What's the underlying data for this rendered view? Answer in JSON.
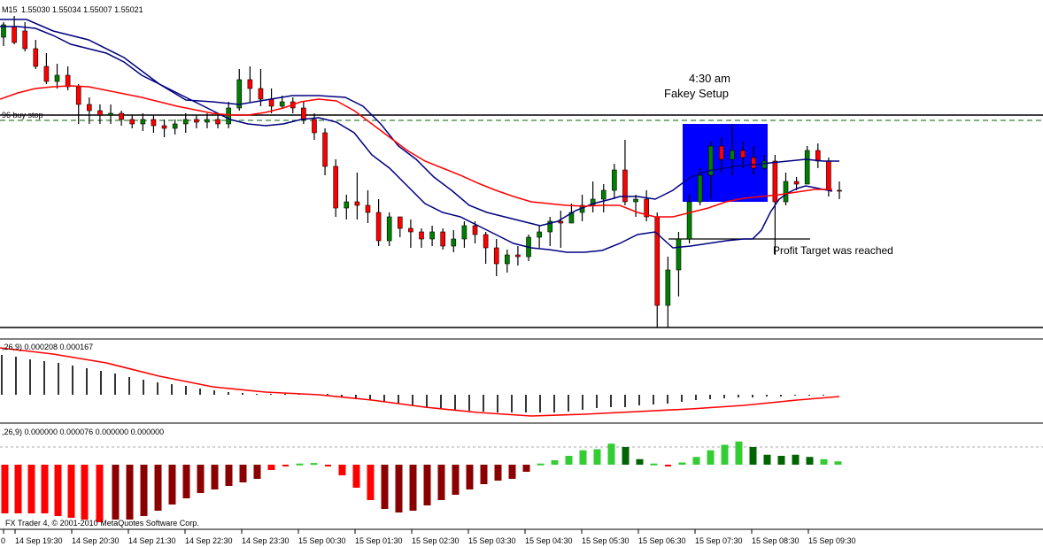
{
  "window": {
    "timeframe": "M15",
    "ohlc_readout": "1.55030 1.55034 1.55007 1.55021"
  },
  "annotations": {
    "time_label": "4:30 am",
    "setup_label": "Fakey Setup",
    "target_label": "Profit Target was reached",
    "buy_stop_label": "96 buy stop"
  },
  "indicators": {
    "macd_header": ",26,9) 0.000208 0.000167",
    "osma_header": ",26,9) 0.000000 0.000076 0.000000 0.000000"
  },
  "footer": {
    "copyright": "FX Trader 4, © 2001-2010 MetaQuotes Software Corp."
  },
  "colors": {
    "bull": "#008000",
    "bear": "#ff0000",
    "ma_fast": "#000080",
    "ma_slow": "#ff0000",
    "setup_box": "#0000ff",
    "hist_up": "#33cc33",
    "hist_up_dark": "#006400",
    "hist_down": "#ff0000",
    "hist_down_dark": "#8b0000"
  },
  "chart_data": {
    "type": "candlestick",
    "x_ticks": [
      "0",
      "14 Sep 19:30",
      "14 Sep 20:30",
      "14 Sep 21:30",
      "14 Sep 22:30",
      "14 Sep 23:30",
      "15 Sep 00:30",
      "15 Sep 01:30",
      "15 Sep 02:30",
      "15 Sep 03:30",
      "15 Sep 04:30",
      "15 Sep 05:30",
      "15 Sep 06:30",
      "15 Sep 07:30",
      "15 Sep 08:30",
      "15 Sep 09:30"
    ],
    "price_bars": [
      [
        42,
        28,
        25,
        52
      ],
      [
        30,
        48,
        18,
        50
      ],
      [
        35,
        55,
        25,
        58
      ],
      [
        55,
        75,
        45,
        78
      ],
      [
        75,
        92,
        60,
        95
      ],
      [
        92,
        85,
        72,
        100
      ],
      [
        85,
        98,
        75,
        102
      ],
      [
        98,
        118,
        95,
        140
      ],
      [
        118,
        125,
        110,
        140
      ],
      [
        125,
        130,
        118,
        140
      ],
      [
        130,
        128,
        118,
        140
      ],
      [
        128,
        135,
        125,
        142
      ],
      [
        135,
        140,
        130,
        145
      ],
      [
        140,
        135,
        128,
        148
      ],
      [
        135,
        142,
        130,
        150
      ],
      [
        142,
        145,
        135,
        155
      ],
      [
        145,
        140,
        135,
        152
      ],
      [
        140,
        135,
        128,
        150
      ],
      [
        135,
        138,
        130,
        145
      ],
      [
        138,
        135,
        128,
        145
      ],
      [
        135,
        140,
        130,
        145
      ],
      [
        140,
        122,
        115,
        145
      ],
      [
        122,
        90,
        78,
        125
      ],
      [
        90,
        100,
        75,
        115
      ],
      [
        100,
        112,
        78,
        120
      ],
      [
        112,
        120,
        100,
        128
      ],
      [
        120,
        115,
        108,
        122
      ],
      [
        115,
        122,
        110,
        128
      ],
      [
        122,
        135,
        115,
        140
      ],
      [
        135,
        150,
        128,
        158
      ],
      [
        150,
        188,
        145,
        198
      ],
      [
        188,
        235,
        180,
        245
      ],
      [
        235,
        228,
        220,
        248
      ],
      [
        228,
        232,
        195,
        248
      ],
      [
        232,
        240,
        215,
        252
      ],
      [
        240,
        272,
        225,
        278
      ],
      [
        272,
        245,
        240,
        278
      ],
      [
        245,
        258,
        245,
        268
      ],
      [
        258,
        262,
        248,
        280
      ],
      [
        262,
        270,
        258,
        280
      ],
      [
        270,
        262,
        255,
        278
      ],
      [
        262,
        278,
        258,
        282
      ],
      [
        278,
        270,
        260,
        285
      ],
      [
        270,
        255,
        250,
        280
      ],
      [
        255,
        265,
        250,
        275
      ],
      [
        265,
        280,
        262,
        298
      ],
      [
        280,
        298,
        270,
        312
      ],
      [
        298,
        288,
        282,
        308
      ],
      [
        288,
        290,
        278,
        300
      ],
      [
        290,
        268,
        265,
        295
      ],
      [
        268,
        262,
        255,
        280
      ],
      [
        262,
        250,
        245,
        278
      ],
      [
        250,
        252,
        238,
        280
      ],
      [
        252,
        240,
        230,
        252
      ],
      [
        240,
        232,
        220,
        250
      ],
      [
        232,
        225,
        205,
        240
      ],
      [
        225,
        215,
        208,
        240
      ],
      [
        215,
        192,
        185,
        225
      ],
      [
        192,
        228,
        158,
        232
      ],
      [
        228,
        225,
        220,
        245
      ],
      [
        225,
        245,
        215,
        250
      ],
      [
        245,
        345,
        240,
        370
      ],
      [
        345,
        305,
        290,
        370
      ],
      [
        305,
        270,
        262,
        335
      ],
      [
        270,
        228,
        220,
        275
      ],
      [
        228,
        198,
        190,
        232
      ],
      [
        198,
        165,
        160,
        225
      ],
      [
        165,
        180,
        155,
        195
      ],
      [
        180,
        170,
        140,
        198
      ],
      [
        170,
        178,
        160,
        190
      ],
      [
        178,
        190,
        165,
        198
      ],
      [
        190,
        182,
        175,
        192
      ],
      [
        182,
        228,
        175,
        288
      ],
      [
        228,
        205,
        195,
        232
      ],
      [
        205,
        208,
        200,
        215
      ],
      [
        208,
        170,
        165,
        180
      ],
      [
        170,
        182,
        162,
        190
      ],
      [
        182,
        215,
        178,
        222
      ],
      [
        215,
        215,
        205,
        225
      ]
    ],
    "ma_fast": [
      [
        0,
        30
      ],
      [
        20,
        30
      ],
      [
        40,
        32
      ],
      [
        60,
        40
      ],
      [
        80,
        50
      ],
      [
        100,
        55
      ],
      [
        120,
        60
      ],
      [
        140,
        70
      ],
      [
        160,
        85
      ],
      [
        180,
        95
      ],
      [
        200,
        105
      ],
      [
        220,
        115
      ],
      [
        240,
        125
      ],
      [
        260,
        135
      ],
      [
        280,
        140
      ],
      [
        300,
        142
      ],
      [
        320,
        140
      ],
      [
        340,
        135
      ],
      [
        360,
        133
      ],
      [
        380,
        138
      ],
      [
        400,
        150
      ],
      [
        420,
        175
      ],
      [
        440,
        190
      ],
      [
        460,
        210
      ],
      [
        480,
        230
      ],
      [
        500,
        240
      ],
      [
        520,
        245
      ],
      [
        540,
        255
      ],
      [
        560,
        265
      ],
      [
        580,
        275
      ],
      [
        600,
        280
      ],
      [
        620,
        282
      ],
      [
        640,
        285
      ],
      [
        660,
        285
      ],
      [
        680,
        283
      ],
      [
        700,
        275
      ],
      [
        720,
        265
      ],
      [
        740,
        262
      ],
      [
        760,
        280
      ],
      [
        780,
        278
      ],
      [
        800,
        275
      ],
      [
        820,
        272
      ],
      [
        840,
        270
      ],
      [
        850,
        270
      ],
      [
        860,
        260
      ],
      [
        870,
        240
      ],
      [
        880,
        225
      ],
      [
        890,
        218
      ],
      [
        900,
        213
      ],
      [
        910,
        210
      ],
      [
        920,
        212
      ],
      [
        930,
        214
      ],
      [
        940,
        216
      ]
    ],
    "ma_slow": [
      [
        0,
        112
      ],
      [
        20,
        105
      ],
      [
        40,
        100
      ],
      [
        60,
        98
      ],
      [
        80,
        97
      ],
      [
        100,
        98
      ],
      [
        120,
        102
      ],
      [
        140,
        106
      ],
      [
        160,
        110
      ],
      [
        180,
        115
      ],
      [
        200,
        120
      ],
      [
        220,
        124
      ],
      [
        240,
        128
      ],
      [
        260,
        130
      ],
      [
        280,
        130
      ],
      [
        300,
        127
      ],
      [
        320,
        122
      ],
      [
        340,
        115
      ],
      [
        360,
        112
      ],
      [
        380,
        114
      ],
      [
        400,
        125
      ],
      [
        420,
        140
      ],
      [
        440,
        155
      ],
      [
        460,
        170
      ],
      [
        480,
        182
      ],
      [
        500,
        190
      ],
      [
        520,
        198
      ],
      [
        540,
        207
      ],
      [
        560,
        215
      ],
      [
        580,
        222
      ],
      [
        600,
        228
      ],
      [
        620,
        230
      ],
      [
        640,
        232
      ],
      [
        660,
        233
      ],
      [
        680,
        232
      ],
      [
        700,
        232
      ],
      [
        720,
        240
      ],
      [
        740,
        245
      ],
      [
        760,
        245
      ],
      [
        780,
        240
      ],
      [
        800,
        235
      ],
      [
        820,
        228
      ],
      [
        840,
        224
      ],
      [
        860,
        222
      ],
      [
        880,
        220
      ],
      [
        900,
        217
      ],
      [
        920,
        214
      ],
      [
        940,
        214
      ]
    ],
    "bb_upper": [
      [
        0,
        22
      ],
      [
        30,
        22
      ],
      [
        60,
        35
      ],
      [
        100,
        45
      ],
      [
        140,
        65
      ],
      [
        180,
        95
      ],
      [
        210,
        113
      ],
      [
        240,
        115
      ],
      [
        270,
        118
      ],
      [
        300,
        113
      ],
      [
        330,
        108
      ],
      [
        360,
        108
      ],
      [
        390,
        110
      ],
      [
        410,
        120
      ],
      [
        430,
        140
      ],
      [
        450,
        165
      ],
      [
        470,
        180
      ],
      [
        490,
        200
      ],
      [
        510,
        215
      ],
      [
        530,
        232
      ],
      [
        550,
        240
      ],
      [
        570,
        245
      ],
      [
        590,
        250
      ],
      [
        610,
        255
      ],
      [
        630,
        250
      ],
      [
        650,
        238
      ],
      [
        670,
        230
      ],
      [
        690,
        225
      ],
      [
        700,
        222
      ],
      [
        720,
        222
      ],
      [
        740,
        225
      ],
      [
        760,
        215
      ],
      [
        780,
        200
      ],
      [
        800,
        193
      ],
      [
        830,
        188
      ],
      [
        860,
        185
      ],
      [
        890,
        182
      ],
      [
        910,
        180
      ],
      [
        930,
        182
      ],
      [
        948,
        182
      ]
    ],
    "macd_histogram": [
      [
        2,
        -45
      ],
      [
        18,
        -43
      ],
      [
        34,
        -40
      ],
      [
        50,
        -38
      ],
      [
        66,
        -36
      ],
      [
        82,
        -33
      ],
      [
        98,
        -30
      ],
      [
        114,
        -27
      ],
      [
        130,
        -24
      ],
      [
        146,
        -20
      ],
      [
        162,
        -17
      ],
      [
        178,
        -14
      ],
      [
        194,
        -12
      ],
      [
        210,
        -10
      ],
      [
        226,
        -7
      ],
      [
        242,
        -5
      ],
      [
        258,
        -3
      ],
      [
        274,
        -2
      ],
      [
        290,
        -1
      ],
      [
        306,
        -1
      ],
      [
        322,
        -1
      ],
      [
        338,
        -1
      ],
      [
        354,
        -1
      ],
      [
        370,
        -1
      ],
      [
        386,
        3
      ],
      [
        402,
        5
      ],
      [
        418,
        6
      ],
      [
        434,
        8
      ],
      [
        450,
        10
      ],
      [
        466,
        12
      ],
      [
        482,
        14
      ],
      [
        498,
        15
      ],
      [
        514,
        17
      ],
      [
        530,
        18
      ],
      [
        546,
        19
      ],
      [
        562,
        20
      ],
      [
        578,
        20
      ],
      [
        594,
        20
      ],
      [
        610,
        20
      ],
      [
        626,
        20
      ],
      [
        642,
        19
      ],
      [
        658,
        17
      ],
      [
        674,
        15
      ],
      [
        690,
        14
      ],
      [
        706,
        14
      ],
      [
        722,
        12
      ],
      [
        738,
        11
      ],
      [
        754,
        10
      ],
      [
        770,
        8
      ],
      [
        786,
        6
      ],
      [
        802,
        5
      ],
      [
        818,
        4
      ],
      [
        834,
        3
      ],
      [
        850,
        3
      ],
      [
        866,
        2
      ],
      [
        882,
        2
      ],
      [
        898,
        1
      ],
      [
        914,
        1
      ],
      [
        930,
        1
      ]
    ],
    "macd_signal": [
      [
        0,
        393
      ],
      [
        60,
        400
      ],
      [
        120,
        410
      ],
      [
        180,
        425
      ],
      [
        240,
        437
      ],
      [
        300,
        443
      ],
      [
        360,
        446
      ],
      [
        420,
        452
      ],
      [
        480,
        460
      ],
      [
        540,
        466
      ],
      [
        600,
        470
      ],
      [
        660,
        468
      ],
      [
        720,
        465
      ],
      [
        780,
        462
      ],
      [
        840,
        458
      ],
      [
        900,
        452
      ],
      [
        948,
        448
      ]
    ],
    "osma_histogram": [
      [
        5,
        -55
      ],
      [
        20,
        -55
      ],
      [
        35,
        -55
      ],
      [
        50,
        -55
      ],
      [
        65,
        -58
      ],
      [
        80,
        -60
      ],
      [
        95,
        -62
      ],
      [
        112,
        -65
      ],
      [
        130,
        -62
      ],
      [
        146,
        -62
      ],
      [
        162,
        -58
      ],
      [
        178,
        -52
      ],
      [
        194,
        -45
      ],
      [
        210,
        -38
      ],
      [
        226,
        -32
      ],
      [
        242,
        -28
      ],
      [
        258,
        -24
      ],
      [
        274,
        -20
      ],
      [
        290,
        -16
      ],
      [
        306,
        -6
      ],
      [
        322,
        -1
      ],
      [
        338,
        2
      ],
      [
        354,
        3
      ],
      [
        370,
        -4
      ],
      [
        386,
        -12
      ],
      [
        402,
        -26
      ],
      [
        418,
        -40
      ],
      [
        434,
        -50
      ],
      [
        450,
        -54
      ],
      [
        466,
        -52
      ],
      [
        482,
        -46
      ],
      [
        498,
        -40
      ],
      [
        514,
        -34
      ],
      [
        530,
        -28
      ],
      [
        546,
        -22
      ],
      [
        562,
        -18
      ],
      [
        578,
        -16
      ],
      [
        594,
        -8
      ],
      [
        610,
        2
      ],
      [
        626,
        8
      ],
      [
        642,
        16
      ],
      [
        658,
        26
      ],
      [
        674,
        28
      ],
      [
        690,
        38
      ],
      [
        706,
        32
      ],
      [
        722,
        10
      ],
      [
        738,
        2
      ],
      [
        754,
        -4
      ],
      [
        770,
        4
      ],
      [
        786,
        14
      ],
      [
        802,
        26
      ],
      [
        818,
        36
      ],
      [
        834,
        42
      ],
      [
        850,
        32
      ],
      [
        866,
        18
      ],
      [
        882,
        16
      ],
      [
        898,
        18
      ],
      [
        914,
        14
      ],
      [
        930,
        10
      ],
      [
        946,
        6
      ]
    ]
  }
}
